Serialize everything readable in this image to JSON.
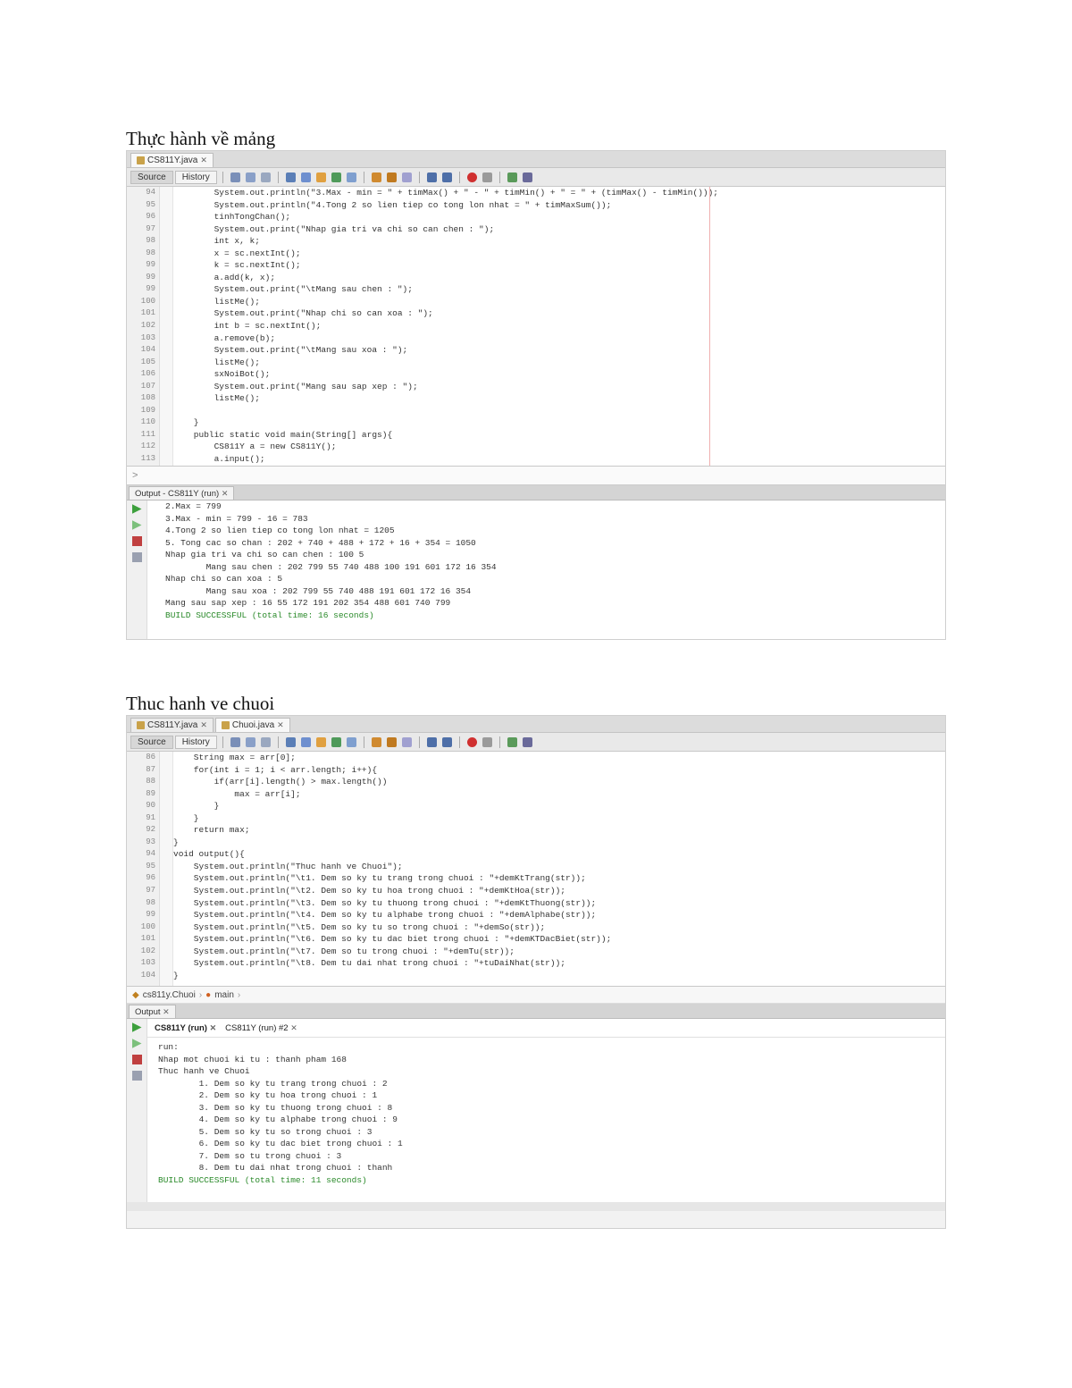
{
  "section1": {
    "heading": "Thực hành về mảng",
    "tabs": [
      {
        "label": "CS811Y.java"
      }
    ],
    "toolbar": {
      "source": "Source",
      "history": "History"
    },
    "line_numbers": [
      "94",
      "95",
      "96",
      "97",
      "98",
      "98",
      "99",
      "99",
      "99",
      "100",
      "101",
      "102",
      "103",
      "104",
      "105",
      "106",
      "107",
      "108",
      "109",
      "110",
      "111",
      "112",
      "113"
    ],
    "code_lines": [
      "        System.out.println(\"3.Max - min = \" + timMax() + \" - \" + timMin() + \" = \" + (timMax() - timMin()));",
      "        System.out.println(\"4.Tong 2 so lien tiep co tong lon nhat = \" + timMaxSum());",
      "        tinhTongChan();",
      "        System.out.print(\"Nhap gia tri va chi so can chen : \");",
      "        int x, k;",
      "        x = sc.nextInt();",
      "        k = sc.nextInt();",
      "        a.add(k, x);",
      "        System.out.print(\"\\tMang sau chen : \");",
      "        listMe();",
      "        System.out.print(\"Nhap chi so can xoa : \");",
      "        int b = sc.nextInt();",
      "        a.remove(b);",
      "        System.out.print(\"\\tMang sau xoa : \");",
      "        listMe();",
      "        sxNoiBot();",
      "        System.out.print(\"Mang sau sap xep : \");",
      "        listMe();",
      "",
      "    }",
      "    public static void main(String[] args){",
      "        CS811Y a = new CS811Y();",
      "        a.input();"
    ],
    "output_tab": "Output - CS811Y (run)",
    "output_lines": [
      "2.Max = 799",
      "3.Max - min = 799 - 16 = 783",
      "4.Tong 2 so lien tiep co tong lon nhat = 1205",
      "5. Tong cac so chan : 202 + 740 + 488 + 172 + 16 + 354 = 1050",
      "Nhap gia tri va chi so can chen : 100 5",
      "        Mang sau chen : 202 799 55 740 488 100 191 601 172 16 354",
      "Nhap chi so can xoa : 5",
      "        Mang sau xoa : 202 799 55 740 488 191 601 172 16 354",
      "Mang sau sap xep : 16 55 172 191 202 354 488 601 740 799",
      "BUILD SUCCESSFUL (total time: 16 seconds)"
    ]
  },
  "section2": {
    "heading": "Thuc hanh ve chuoi",
    "tabs": [
      {
        "label": "CS811Y.java"
      },
      {
        "label": "Chuoi.java"
      }
    ],
    "toolbar": {
      "source": "Source",
      "history": "History"
    },
    "line_numbers": [
      "86",
      "87",
      "88",
      "89",
      "90",
      "91",
      "92",
      "93",
      "94",
      "95",
      "96",
      "97",
      "98",
      "99",
      "100",
      "101",
      "102",
      "103",
      "104"
    ],
    "code_lines": [
      "    String max = arr[0];",
      "    for(int i = 1; i < arr.length; i++){",
      "        if(arr[i].length() > max.length())",
      "            max = arr[i];",
      "        }",
      "    }",
      "    return max;",
      "}",
      "void output(){",
      "    System.out.println(\"Thuc hanh ve Chuoi\");",
      "    System.out.println(\"\\t1. Dem so ky tu trang trong chuoi : \"+demKtTrang(str));",
      "    System.out.println(\"\\t2. Dem so ky tu hoa trong chuoi : \"+demKtHoa(str));",
      "    System.out.println(\"\\t3. Dem so ky tu thuong trong chuoi : \"+demKtThuong(str));",
      "    System.out.println(\"\\t4. Dem so ky tu alphabe trong chuoi : \"+demAlphabe(str));",
      "    System.out.println(\"\\t5. Dem so ky tu so trong chuoi : \"+demSo(str));",
      "    System.out.println(\"\\t6. Dem so ky tu dac biet trong chuoi : \"+demKTDacBiet(str));",
      "    System.out.println(\"\\t7. Dem so tu trong chuoi : \"+demTu(str));",
      "    System.out.println(\"\\t8. Dem tu dai nhat trong chuoi : \"+tuDaiNhat(str));",
      "}"
    ],
    "breadcrumb": [
      "cs811y.Chuoi",
      "main"
    ],
    "output_panel": "Output",
    "run_tabs": [
      "CS811Y (run)",
      "CS811Y (run) #2"
    ],
    "output_lines": [
      "run:",
      "Nhap mot chuoi ki tu : thanh pham 168",
      "Thuc hanh ve Chuoi",
      "        1. Dem so ky tu trang trong chuoi : 2",
      "        2. Dem so ky tu hoa trong chuoi : 1",
      "        3. Dem so ky tu thuong trong chuoi : 8",
      "        4. Dem so ky tu alphabe trong chuoi : 9",
      "        5. Dem so ky tu so trong chuoi : 3",
      "        6. Dem so ky tu dac biet trong chuoi : 1",
      "        7. Dem so tu trong chuoi : 3",
      "        8. Dem tu dai nhat trong chuoi : thanh",
      "BUILD SUCCESSFUL (total time: 11 seconds)"
    ]
  }
}
